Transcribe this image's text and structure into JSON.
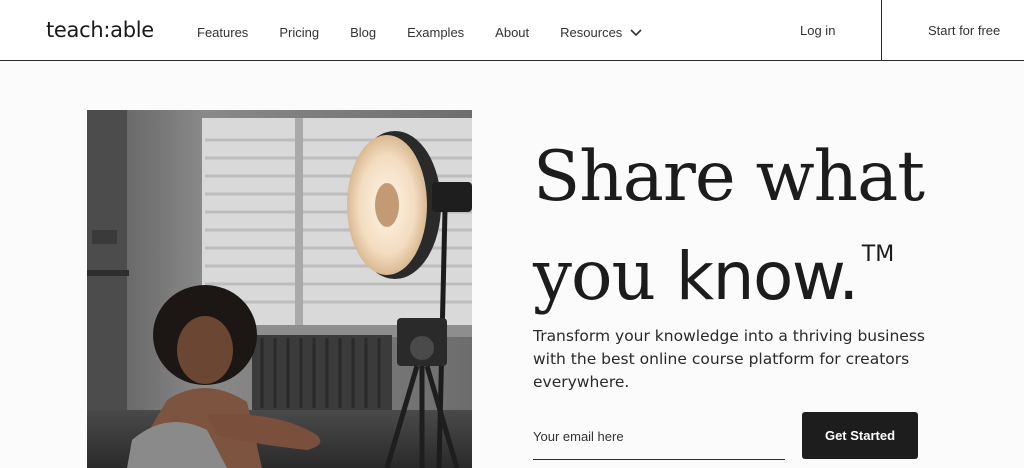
{
  "header": {
    "logo": "teach:able",
    "nav": {
      "features": "Features",
      "pricing": "Pricing",
      "blog": "Blog",
      "examples": "Examples",
      "about": "About",
      "resources": "Resources"
    },
    "login": "Log in",
    "start_free": "Start for free"
  },
  "hero": {
    "headline_line1": "Share what",
    "headline_you": "you ",
    "headline_know": "know.",
    "headline_tm": "TM",
    "subtitle": "Transform your knowledge into a thriving business with the best online course platform for creators everywhere.",
    "email_placeholder": "Your email here",
    "cta_label": "Get Started"
  },
  "colors": {
    "dark": "#1d1d1d",
    "background": "#fbfbfb"
  },
  "icons": {
    "resources_dropdown": "chevron-down-icon"
  }
}
